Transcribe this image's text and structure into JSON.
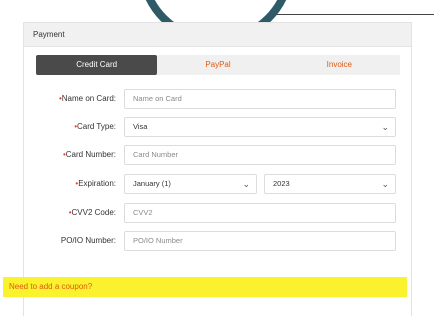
{
  "header": {
    "title": "Payment"
  },
  "tabs": [
    {
      "label": "Credit Card",
      "active": true
    },
    {
      "label": "PayPal",
      "active": false
    },
    {
      "label": "Invoice",
      "active": false
    }
  ],
  "form": {
    "name_on_card": {
      "label": "Name on Card:",
      "required": true,
      "placeholder": "Name on Card",
      "value": ""
    },
    "card_type": {
      "label": "Card Type:",
      "required": true,
      "value": "Visa"
    },
    "card_number": {
      "label": "Card Number:",
      "required": true,
      "placeholder": "Card Number",
      "value": ""
    },
    "expiration": {
      "label": "Expiration:",
      "required": true,
      "month": "January (1)",
      "year": "2023"
    },
    "cvv2": {
      "label": "CVV2 Code:",
      "required": true,
      "placeholder": "CVV2",
      "value": ""
    },
    "po_number": {
      "label": "PO/IO Number:",
      "required": false,
      "placeholder": "PO/IO Number",
      "value": ""
    }
  },
  "coupon": {
    "label": "Need to add a coupon?"
  },
  "colors": {
    "accent": "#e05a12",
    "active_tab": "#4a4a4a",
    "highlight": "#fbf22e",
    "required": "#e53935",
    "logo_ring": "#2f5a68"
  },
  "icons": {
    "select": "chevron-down-icon"
  }
}
